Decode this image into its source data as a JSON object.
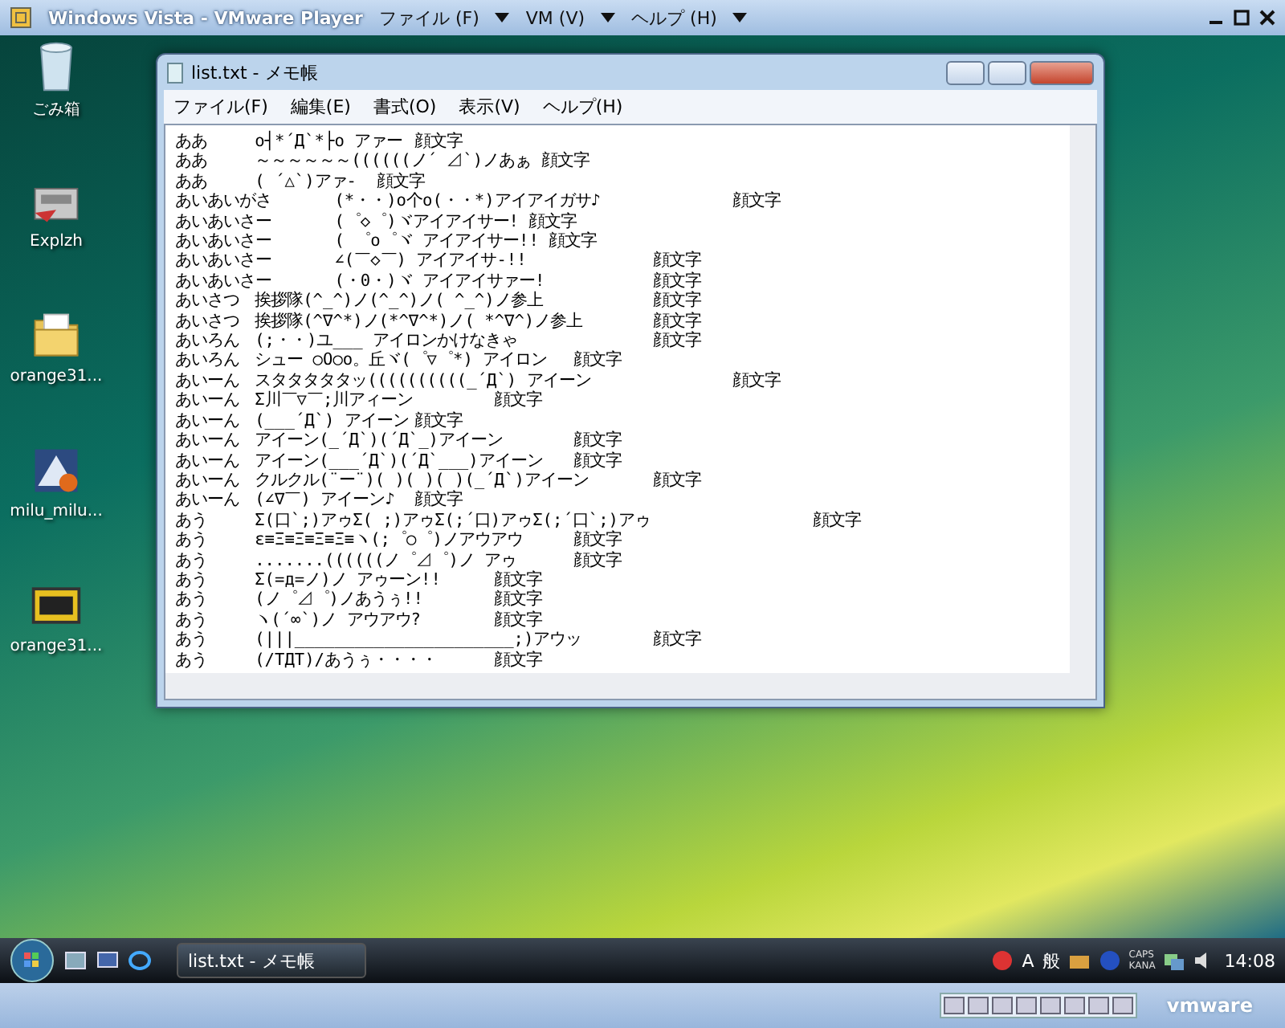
{
  "vmware_window": {
    "title": "Windows Vista - VMware Player",
    "menus": [
      "ファイル (F)",
      "VM (V)",
      "ヘルプ (H)"
    ]
  },
  "desktop_icons": [
    {
      "label": "ごみ箱",
      "kind": "trash"
    },
    {
      "label": "Explzh",
      "kind": "archiver"
    },
    {
      "label": "orange31...",
      "kind": "folder"
    },
    {
      "label": "milu_milu...",
      "kind": "installer"
    },
    {
      "label": "orange31...",
      "kind": "lzh"
    }
  ],
  "notepad": {
    "title": "list.txt - メモ帳",
    "menu": [
      "ファイル(F)",
      "編集(E)",
      "書式(O)",
      "表示(V)",
      "ヘルプ(H)"
    ],
    "lines": [
      "ああ\to┤*´Д`*├o アァー\t顔文字",
      "ああ\t～～～～～～((((((ノ´ ⊿`)ノあぁ 顔文字",
      "ああ\t( ´△`)アァ-  顔文字",
      "あいあいがさ\t(*・・)o个o(・・*)アイアイガサ♪\t\t顔文字",
      "あいあいさー\t(゜◇゜)ヾアイアイサー! 顔文字",
      "あいあいさー\t( ゜o゜ヾ アイアイサー!! 顔文字",
      "あいあいさー\t∠(￣◇￣) アイアイサ-!!\t\t顔文字",
      "あいあいさー\t(・0・)ヾ アイアイサァー!\t\t顔文字",
      "あいさつ\t挨拶隊(^_^)ノ(^_^)ノ( ^_^)ノ参上\t\t顔文字",
      "あいさつ\t挨拶隊(^∇^*)ノ(*^∇^*)ノ( *^∇^)ノ参上\t顔文字",
      "あいろん\t(;・・)ユ___ アイロンかけなきゃ\t\t顔文字",
      "あいろん\tシュー ○O○o。丘ヾ(゜▽゜*) アイロン\t顔文字",
      "あいーん\tスタタタタタッ((((((((((_´Д`) アイーン\t\t顔文字",
      "あいーん\tΣ川￣▽￣;川アィーン\t顔文字",
      "あいーん\t(___´Д`) アイーン\t顔文字",
      "あいーん\tアイーン(_´Д`)(´Д`_)アイーン\t顔文字",
      "あいーん\tアイーン(___´Д`)(´Д`___)アイーン\t顔文字",
      "あいーん\tクルクル(¨ー¨)( )( )( )(_´Д`)アイーン\t顔文字",
      "あいーん\t(∠∇￣) アイーン♪\t顔文字",
      "あう\tΣ(口`;)アゥΣ( ;)アゥΣ(;´口)アゥΣ(;´口`;)アゥ\t\t顔文字",
      "あう\tε≡Ξ≡Ξ≡Ξ≡Ξ≡ヽ(;゜○゜)ノアウアウ\t顔文字",
      "あう\t.......((((((ノ゜⊿゜)ノ アゥ\t顔文字",
      "あう\tΣ(=д=ノ)ノ アゥーン!!\t顔文字",
      "あう\t(ノ゜⊿゜)ノあうぅ!!\t顔文字",
      "あう\tヽ(´∞`)ノ アウアウ?\t顔文字",
      "あう\t(|||______________________;)アウッ\t顔文字",
      "あう\t(/TДT)/あうぅ・・・・\t顔文字"
    ]
  },
  "taskbar": {
    "tasks": [
      {
        "label": "list.txt - メモ帳",
        "selected": true
      }
    ],
    "ime": [
      "A",
      "般"
    ],
    "caps": "CAPS",
    "kana": "KANA",
    "clock": "14:08"
  },
  "vmware_status": {
    "brand": "vmware"
  }
}
